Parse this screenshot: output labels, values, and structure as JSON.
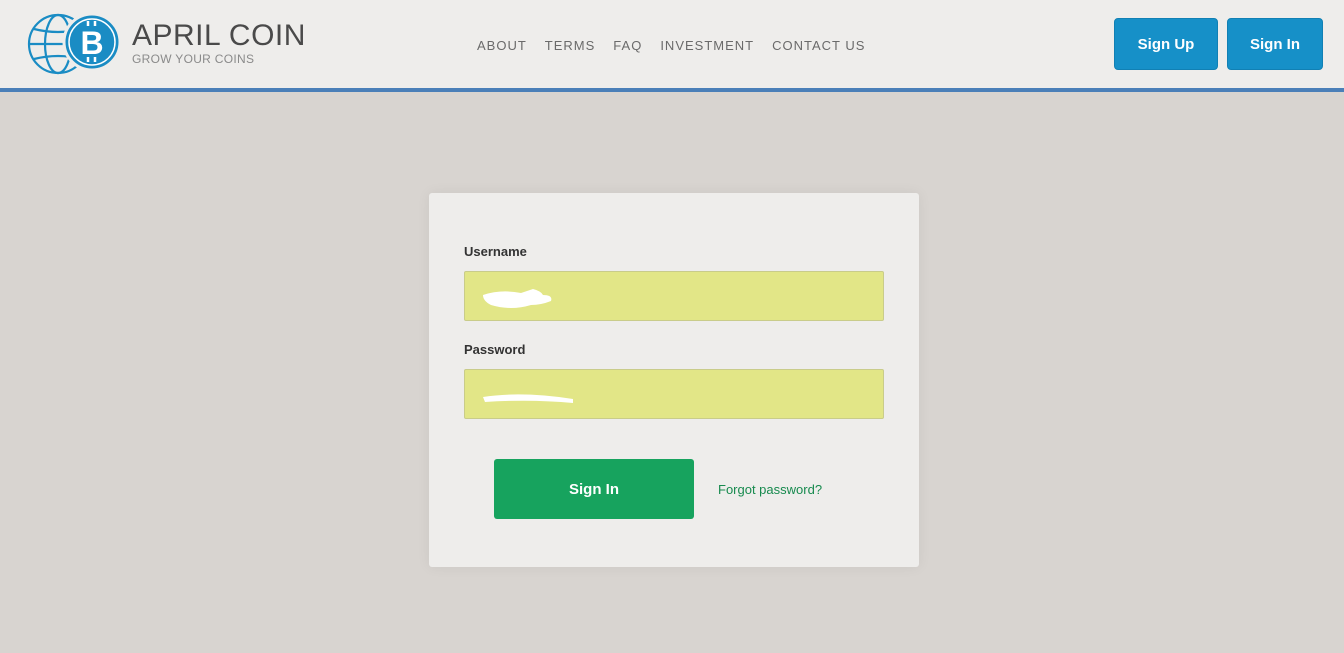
{
  "brand": {
    "name": "APRIL COIN",
    "tagline": "GROW YOUR COINS",
    "logo_icon": "bitcoin-globe-icon",
    "logo_color": "#1a8cc4"
  },
  "nav": {
    "items": [
      {
        "label": "ABOUT"
      },
      {
        "label": "TERMS"
      },
      {
        "label": "FAQ"
      },
      {
        "label": "INVESTMENT"
      },
      {
        "label": "CONTACT US"
      }
    ]
  },
  "header_actions": {
    "signup_label": "Sign Up",
    "signin_label": "Sign In",
    "button_color": "#1690c8"
  },
  "login": {
    "username_label": "Username",
    "username_value": "",
    "password_label": "Password",
    "password_value": "",
    "submit_label": "Sign In",
    "forgot_label": "Forgot password?",
    "input_fill_color": "#e2e687",
    "submit_color": "#17a35e"
  }
}
